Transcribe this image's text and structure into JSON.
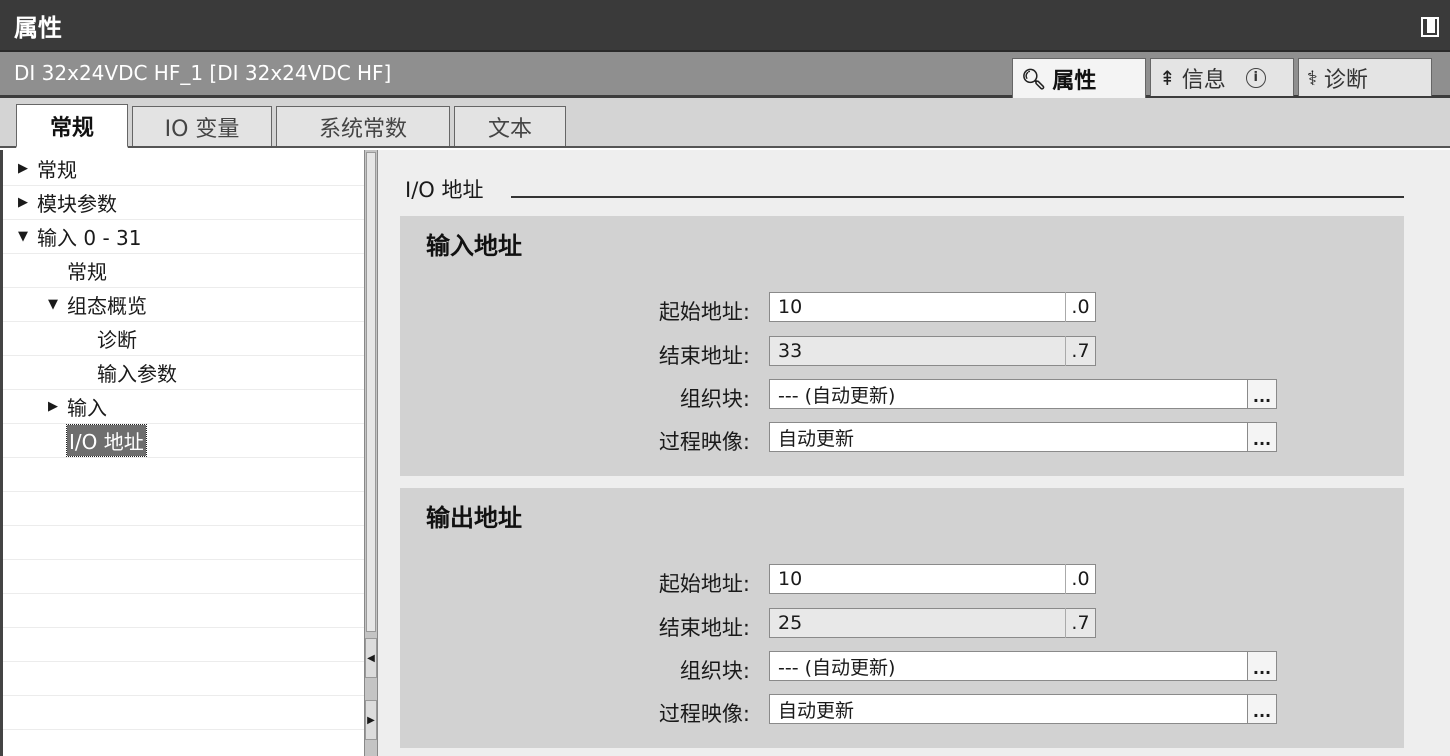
{
  "window": {
    "title": "属性"
  },
  "object": {
    "name": "DI 32x24VDC HF_1 [DI 32x24VDC HF]"
  },
  "panel_tabs": [
    {
      "label": "属性",
      "icon": "properties-icon",
      "active": true
    },
    {
      "label": "信息",
      "icon": "info-icon",
      "active": false
    },
    {
      "label": "诊断",
      "icon": "diagnostics-icon",
      "active": false
    }
  ],
  "sub_tabs": [
    {
      "label": "常规",
      "active": true
    },
    {
      "label": "IO 变量",
      "active": false
    },
    {
      "label": "系统常数",
      "active": false
    },
    {
      "label": "文本",
      "active": false
    }
  ],
  "tree": [
    {
      "label": "常规",
      "arrow": "▶"
    },
    {
      "label": "模块参数",
      "arrow": "▶"
    },
    {
      "label": "输入 0 - 31",
      "arrow": "▼"
    },
    {
      "label": "常规",
      "arrow": ""
    },
    {
      "label": "组态概览",
      "arrow": "▼"
    },
    {
      "label": "诊断",
      "arrow": ""
    },
    {
      "label": "输入参数",
      "arrow": ""
    },
    {
      "label": "输入",
      "arrow": "▶"
    },
    {
      "label": "I/O 地址",
      "arrow": "",
      "selected": true
    }
  ],
  "section": {
    "title": "I/O 地址"
  },
  "input_group": {
    "title": "输入地址",
    "start_label": "起始地址:",
    "start_value": "10",
    "start_bit": ".0",
    "end_label": "结束地址:",
    "end_value": "33",
    "end_bit": ".7",
    "ob_label": "组织块:",
    "ob_value": "--- (自动更新)",
    "pi_label": "过程映像:",
    "pi_value": "自动更新",
    "browse": "..."
  },
  "output_group": {
    "title": "输出地址",
    "start_label": "起始地址:",
    "start_value": "10",
    "start_bit": ".0",
    "end_label": "结束地址:",
    "end_value": "25",
    "end_bit": ".7",
    "ob_label": "组织块:",
    "ob_value": "--- (自动更新)",
    "pi_label": "过程映像:",
    "pi_value": "自动更新",
    "browse": "..."
  },
  "colors": {
    "titlebar": "#3a3a3a",
    "objbar": "#8f8f8f",
    "group_bg": "#d2d2d2",
    "selected": "#6e6e6e"
  }
}
